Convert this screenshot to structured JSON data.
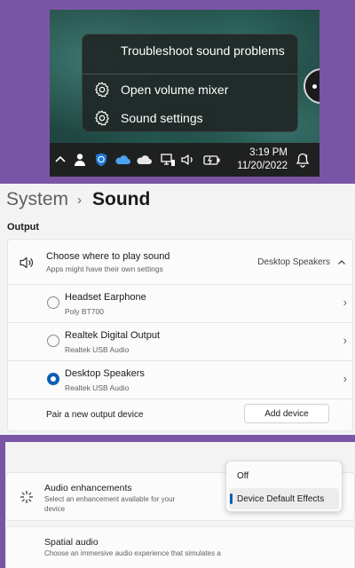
{
  "context_menu": {
    "items": [
      {
        "label": "Troubleshoot sound problems",
        "icon": "none"
      },
      {
        "label": "Open volume mixer",
        "icon": "gear-icon"
      },
      {
        "label": "Sound settings",
        "icon": "gear-icon"
      }
    ]
  },
  "taskbar": {
    "tray_icons": [
      "chevron-up-icon",
      "person-icon",
      "shield-icon",
      "onedrive-icon",
      "cloud-icon",
      "network-icon",
      "speaker-icon",
      "battery-icon"
    ],
    "time": "3:19 PM",
    "date": "11/20/2022",
    "notification_icon": "notification-bell-icon"
  },
  "settings": {
    "breadcrumb": {
      "parent": "System",
      "separator": "›",
      "current": "Sound"
    },
    "output_heading": "Output",
    "choose_output": {
      "title": "Choose where to play sound",
      "subtitle": "Apps might have their own settings",
      "selected_value": "Desktop Speakers",
      "icon": "speaker-icon"
    },
    "devices": [
      {
        "name": "Headset Earphone",
        "detail": "Poly BT700",
        "selected": false
      },
      {
        "name": "Realtek Digital Output",
        "detail": "Realtek USB Audio",
        "selected": false
      },
      {
        "name": "Desktop Speakers",
        "detail": "Realtek USB Audio",
        "selected": true
      }
    ],
    "pair_label": "Pair a new output device",
    "add_device_label": "Add device"
  },
  "enhancements": {
    "audio_enhancements_title": "Audio enhancements",
    "audio_enhancements_subtitle_line1": "Select an enhancement available for your",
    "audio_enhancements_subtitle_line2": "device",
    "spatial_title": "Spatial audio",
    "spatial_subtitle": "Choose an immersive audio experience that simulates a",
    "dropdown_options": [
      "Off",
      "Device Default Effects"
    ],
    "dropdown_selected": "Device Default Effects"
  },
  "colors": {
    "accent": "#0f5fb5",
    "frame": "#7a55a6"
  }
}
